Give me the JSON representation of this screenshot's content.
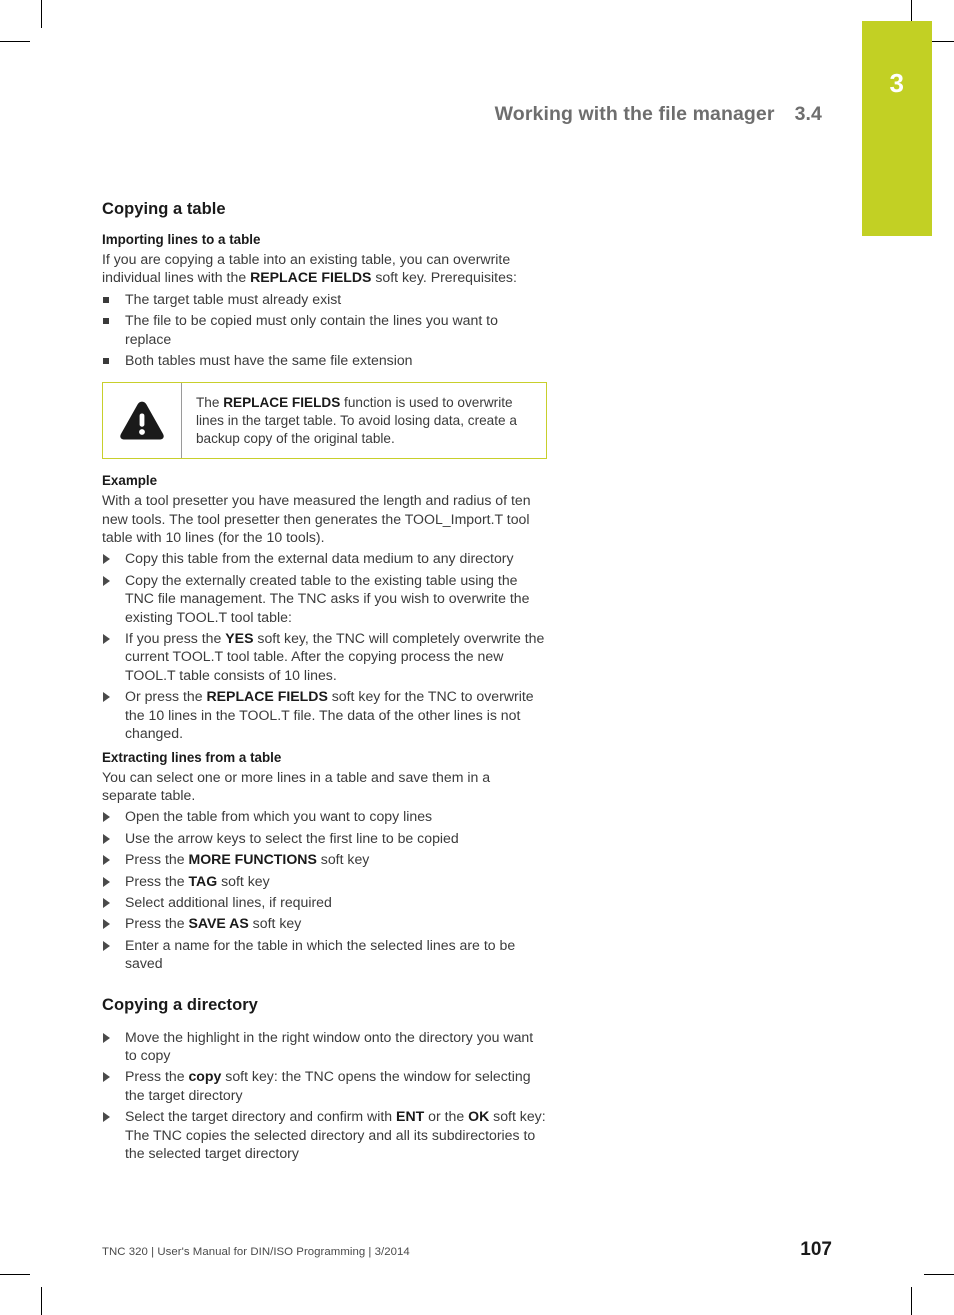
{
  "chapter_tab": {
    "number": "3",
    "color": "#c2d024"
  },
  "running_head": {
    "title": "Working with the file manager",
    "section_number": "3.4",
    "color": "#6e6e6e"
  },
  "content": {
    "section_title": "Copying a table",
    "importing": {
      "heading": "Importing lines to a table",
      "intro_part1": "If you are copying a table into an existing table, you can overwrite individual lines with the ",
      "intro_bold": "REPLACE FIELDS",
      "intro_part2": " soft key. Prerequisites:",
      "bullets": [
        "The target table must already exist",
        "The file to be copied must only contain the lines you want to replace",
        "Both tables must have the same file extension"
      ]
    },
    "note": {
      "icon": "warning-triangle-icon",
      "border_color": "#c8cf2c",
      "text_part1": "The ",
      "text_bold": "REPLACE FIELDS",
      "text_part2": " function is used to overwrite lines in the target table. To avoid losing data, create a backup copy of the original table."
    },
    "example": {
      "heading": "Example",
      "paragraph": "With a tool presetter you have measured the length and radius of ten new tools. The tool presetter then generates the TOOL_Import.T tool table with 10 lines (for the 10 tools).",
      "steps": [
        {
          "part1": "Copy this table from the external data medium to any directory",
          "bold": "",
          "part2": ""
        },
        {
          "part1": "Copy the externally created table to the existing table using the TNC file management. The TNC asks if you wish to overwrite the existing TOOL.T tool table:",
          "bold": "",
          "part2": ""
        },
        {
          "part1": "If you press the ",
          "bold": "YES",
          "part2": " soft key, the TNC will completely overwrite the current TOOL.T tool table. After the copying process the new TOOL.T table consists of 10 lines."
        },
        {
          "part1": "Or press the ",
          "bold": "REPLACE FIELDS",
          "part2": " soft key for the TNC to overwrite the 10 lines in the TOOL.T file. The data of the other lines is not changed."
        }
      ]
    },
    "extracting": {
      "heading": "Extracting lines from a table",
      "paragraph": "You can select one or more lines in a table and save them in a separate table.",
      "steps": [
        {
          "part1": "Open the table from which you want to copy lines",
          "bold": "",
          "part2": ""
        },
        {
          "part1": "Use the arrow keys to select the first line to be copied",
          "bold": "",
          "part2": ""
        },
        {
          "part1": "Press the ",
          "bold": "MORE FUNCTIONS",
          "part2": " soft key"
        },
        {
          "part1": "Press the ",
          "bold": "TAG",
          "part2": " soft key"
        },
        {
          "part1": "Select additional lines, if required",
          "bold": "",
          "part2": ""
        },
        {
          "part1": "Press the ",
          "bold": "SAVE AS",
          "part2": " soft key"
        },
        {
          "part1": "Enter a name for the table in which the selected lines are to be saved",
          "bold": "",
          "part2": ""
        }
      ]
    },
    "copying_directory": {
      "heading": "Copying a directory",
      "steps": [
        {
          "part1": "Move the highlight in the right window onto the directory you want to copy",
          "bold": "",
          "part2": ""
        },
        {
          "part1": "Press the ",
          "bold": "copy",
          "part2": " soft key: the TNC opens the window for selecting the target directory"
        },
        {
          "part1": "Select the target directory and confirm with ",
          "bold": "ENT",
          "part2": " or the ",
          "bold2": "OK",
          "part3": " soft key: The TNC copies the selected directory and all its subdirectories to the selected target directory"
        }
      ]
    }
  },
  "footer": {
    "left": "TNC 320 | User's Manual for DIN/ISO Programming | 3/2014",
    "page_number": "107"
  }
}
